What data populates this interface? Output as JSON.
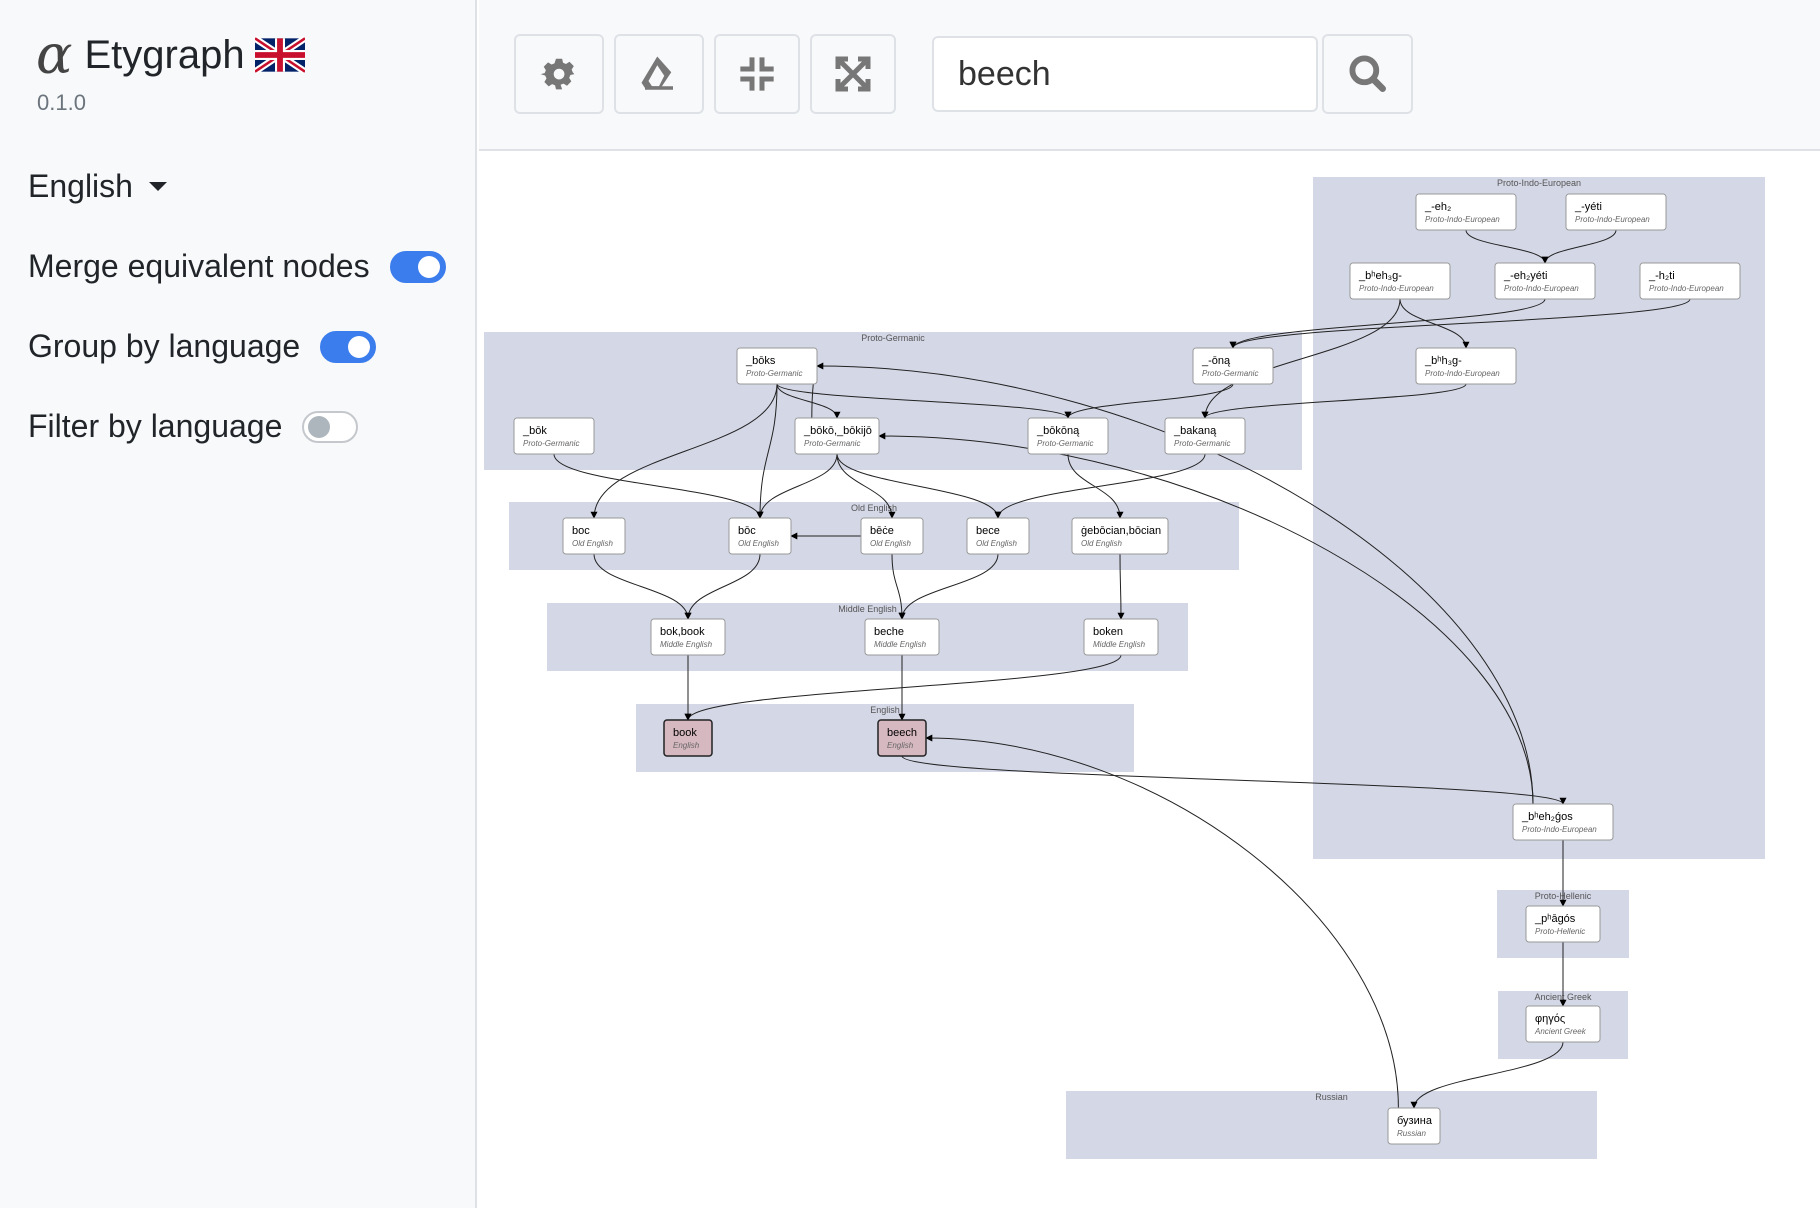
{
  "app": {
    "logo_glyph": "α",
    "title": "Etygraph",
    "version": "0.1.0",
    "flag": "uk-flag"
  },
  "sidebar": {
    "language_select": {
      "selected": "English"
    },
    "options": [
      {
        "label": "Merge equivalent nodes",
        "enabled": true
      },
      {
        "label": "Group by language",
        "enabled": true
      },
      {
        "label": "Filter by language",
        "enabled": false
      }
    ]
  },
  "toolbar": {
    "buttons": [
      {
        "name": "settings",
        "icon": "gear-icon"
      },
      {
        "name": "clear",
        "icon": "eraser-icon"
      },
      {
        "name": "collapse",
        "icon": "compress-icon"
      },
      {
        "name": "expand",
        "icon": "expand-icon"
      }
    ],
    "search": {
      "value": "beech",
      "placeholder": ""
    },
    "search_button_icon": "search-icon"
  },
  "graph": {
    "colors": {
      "cluster": "#d4d7e6",
      "node": "#ffffff",
      "highlight": "#d6b8c0"
    },
    "clusters": [
      {
        "id": "pie",
        "label": "Proto-Indo-European"
      },
      {
        "id": "pg",
        "label": "Proto-Germanic"
      },
      {
        "id": "oe",
        "label": "Old English"
      },
      {
        "id": "me",
        "label": "Middle English"
      },
      {
        "id": "en",
        "label": "English"
      },
      {
        "id": "ph",
        "label": "Proto-Hellenic"
      },
      {
        "id": "grc",
        "label": "Ancient Greek"
      },
      {
        "id": "ru",
        "label": "Russian"
      }
    ],
    "nodes": [
      {
        "id": "eh2",
        "word": "_-eh₂",
        "lang": "Proto-Indo-European"
      },
      {
        "id": "yeti",
        "word": "_-yéti",
        "lang": "Proto-Indo-European"
      },
      {
        "id": "bheh3g",
        "word": "_bʰeh₃g-",
        "lang": "Proto-Indo-European"
      },
      {
        "id": "eh2yeti",
        "word": "_-eh₂yéti",
        "lang": "Proto-Indo-European"
      },
      {
        "id": "h2ti",
        "word": "_-h₂ti",
        "lang": "Proto-Indo-European"
      },
      {
        "id": "bhh3g",
        "word": "_bʰh₃g-",
        "lang": "Proto-Indo-European"
      },
      {
        "id": "boks",
        "word": "_bōks",
        "lang": "Proto-Germanic"
      },
      {
        "id": "ona",
        "word": "_-ōną",
        "lang": "Proto-Germanic"
      },
      {
        "id": "bok_pg",
        "word": "_bōk",
        "lang": "Proto-Germanic"
      },
      {
        "id": "boko",
        "word": "_bōkō,_bōkijō",
        "lang": "Proto-Germanic"
      },
      {
        "id": "bokona",
        "word": "_bōkōną",
        "lang": "Proto-Germanic"
      },
      {
        "id": "bakana",
        "word": "_bakaną",
        "lang": "Proto-Germanic"
      },
      {
        "id": "boc",
        "word": "boc",
        "lang": "Old English"
      },
      {
        "id": "boc2",
        "word": "bōc",
        "lang": "Old English"
      },
      {
        "id": "bece2",
        "word": "bēċe",
        "lang": "Old English"
      },
      {
        "id": "bece",
        "word": "bece",
        "lang": "Old English"
      },
      {
        "id": "gebocian",
        "word": "ġebōcian,bōcian",
        "lang": "Old English"
      },
      {
        "id": "bokbook",
        "word": "bok,book",
        "lang": "Middle English"
      },
      {
        "id": "beche",
        "word": "beche",
        "lang": "Middle English"
      },
      {
        "id": "boken",
        "word": "boken",
        "lang": "Middle English"
      },
      {
        "id": "book",
        "word": "book",
        "lang": "English",
        "highlight": true
      },
      {
        "id": "beech",
        "word": "beech",
        "lang": "English",
        "highlight": true
      },
      {
        "id": "bheh2gos",
        "word": "_bʰeh₂ǵos",
        "lang": "Proto-Indo-European"
      },
      {
        "id": "phagos",
        "word": "_pʰāgós",
        "lang": "Proto-Hellenic"
      },
      {
        "id": "phegos",
        "word": "φηγός",
        "lang": "Ancient Greek"
      },
      {
        "id": "buzina",
        "word": "бузина",
        "lang": "Russian"
      }
    ],
    "edges": [
      [
        "eh2",
        "eh2yeti"
      ],
      [
        "yeti",
        "eh2yeti"
      ],
      [
        "bheh3g",
        "bhh3g"
      ],
      [
        "bheh3g",
        "bakana"
      ],
      [
        "eh2yeti",
        "ona"
      ],
      [
        "h2ti",
        "ona"
      ],
      [
        "bhh3g",
        "bakana"
      ],
      [
        "boks",
        "boko"
      ],
      [
        "boks",
        "bokona"
      ],
      [
        "boks",
        "boc"
      ],
      [
        "boks",
        "boc2"
      ],
      [
        "ona",
        "bokona"
      ],
      [
        "bok_pg",
        "boc2"
      ],
      [
        "boko",
        "boks"
      ],
      [
        "boko",
        "boc2"
      ],
      [
        "boko",
        "bece2"
      ],
      [
        "boko",
        "bece"
      ],
      [
        "bokona",
        "gebocian"
      ],
      [
        "bakana",
        "bece"
      ],
      [
        "bece2",
        "boc2"
      ],
      [
        "boc",
        "bokbook"
      ],
      [
        "boc2",
        "bokbook"
      ],
      [
        "bece2",
        "beche"
      ],
      [
        "bece",
        "beche"
      ],
      [
        "gebocian",
        "boken"
      ],
      [
        "bokbook",
        "book"
      ],
      [
        "beche",
        "beech"
      ],
      [
        "boken",
        "book"
      ],
      [
        "beech",
        "bheh2gos"
      ],
      [
        "bheh2gos",
        "boks"
      ],
      [
        "bheh2gos",
        "boko"
      ],
      [
        "bheh2gos",
        "phagos"
      ],
      [
        "phagos",
        "phegos"
      ],
      [
        "phegos",
        "buzina"
      ],
      [
        "buzina",
        "beech"
      ]
    ]
  }
}
